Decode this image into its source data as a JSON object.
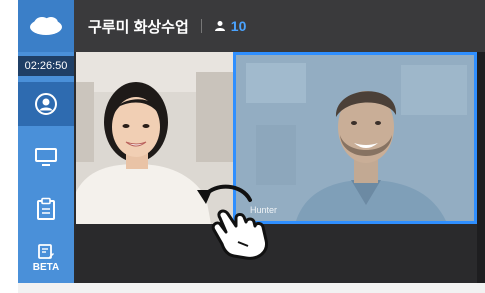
{
  "header": {
    "title": "구루미 화상수업",
    "user_count": "10"
  },
  "sidebar": {
    "timer": "02:26:50",
    "beta_label": "BETA"
  },
  "video": {
    "participant_name": "Hunter"
  },
  "colors": {
    "accent": "#2f8fff",
    "sidebar": "#4a90d9",
    "header": "#3a3a3c"
  }
}
